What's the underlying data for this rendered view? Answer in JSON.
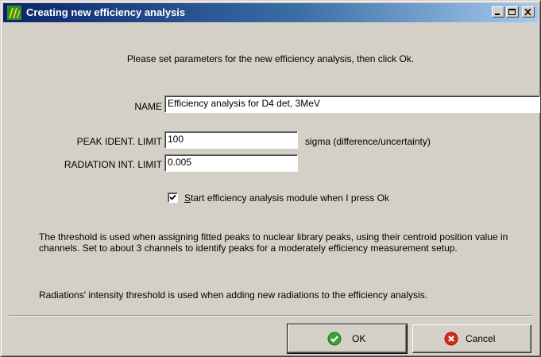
{
  "window": {
    "title": "Creating new efficiency analysis"
  },
  "intro": "Please set parameters for the new efficiency analysis, then click Ok.",
  "name_field": {
    "label": "NAME",
    "value": "Efficiency analysis for D4 det, 3MeV"
  },
  "peak_ident": {
    "label": "PEAK IDENT. LIMIT",
    "value": "100",
    "unit": "sigma (difference/uncertainty)"
  },
  "radiation_limit": {
    "label": "RADIATION INT. LIMIT",
    "value": "0.005"
  },
  "start_checkbox": {
    "checked": true,
    "label_underline": "S",
    "label_rest": "tart efficiency analysis module when I press Ok"
  },
  "help": {
    "threshold": "The threshold is used when assigning fitted peaks to nuclear library peaks, using their centroid position value in channels. Set to about 3 channels to identify peaks for a moderately efficiency measurement setup.",
    "radiations": "Radiations' intensity threshold is used when adding new radiations to the efficiency analysis."
  },
  "buttons": {
    "ok": "OK",
    "cancel": "Cancel"
  },
  "icons": {
    "app": "app-icon",
    "ok": "check-circle-icon",
    "cancel": "x-circle-icon"
  },
  "colors": {
    "title_start": "#0a246a",
    "title_end": "#a6caf0",
    "face": "#d4d0c8",
    "ok_green": "#3aa335",
    "cancel_red": "#d42a1e"
  }
}
